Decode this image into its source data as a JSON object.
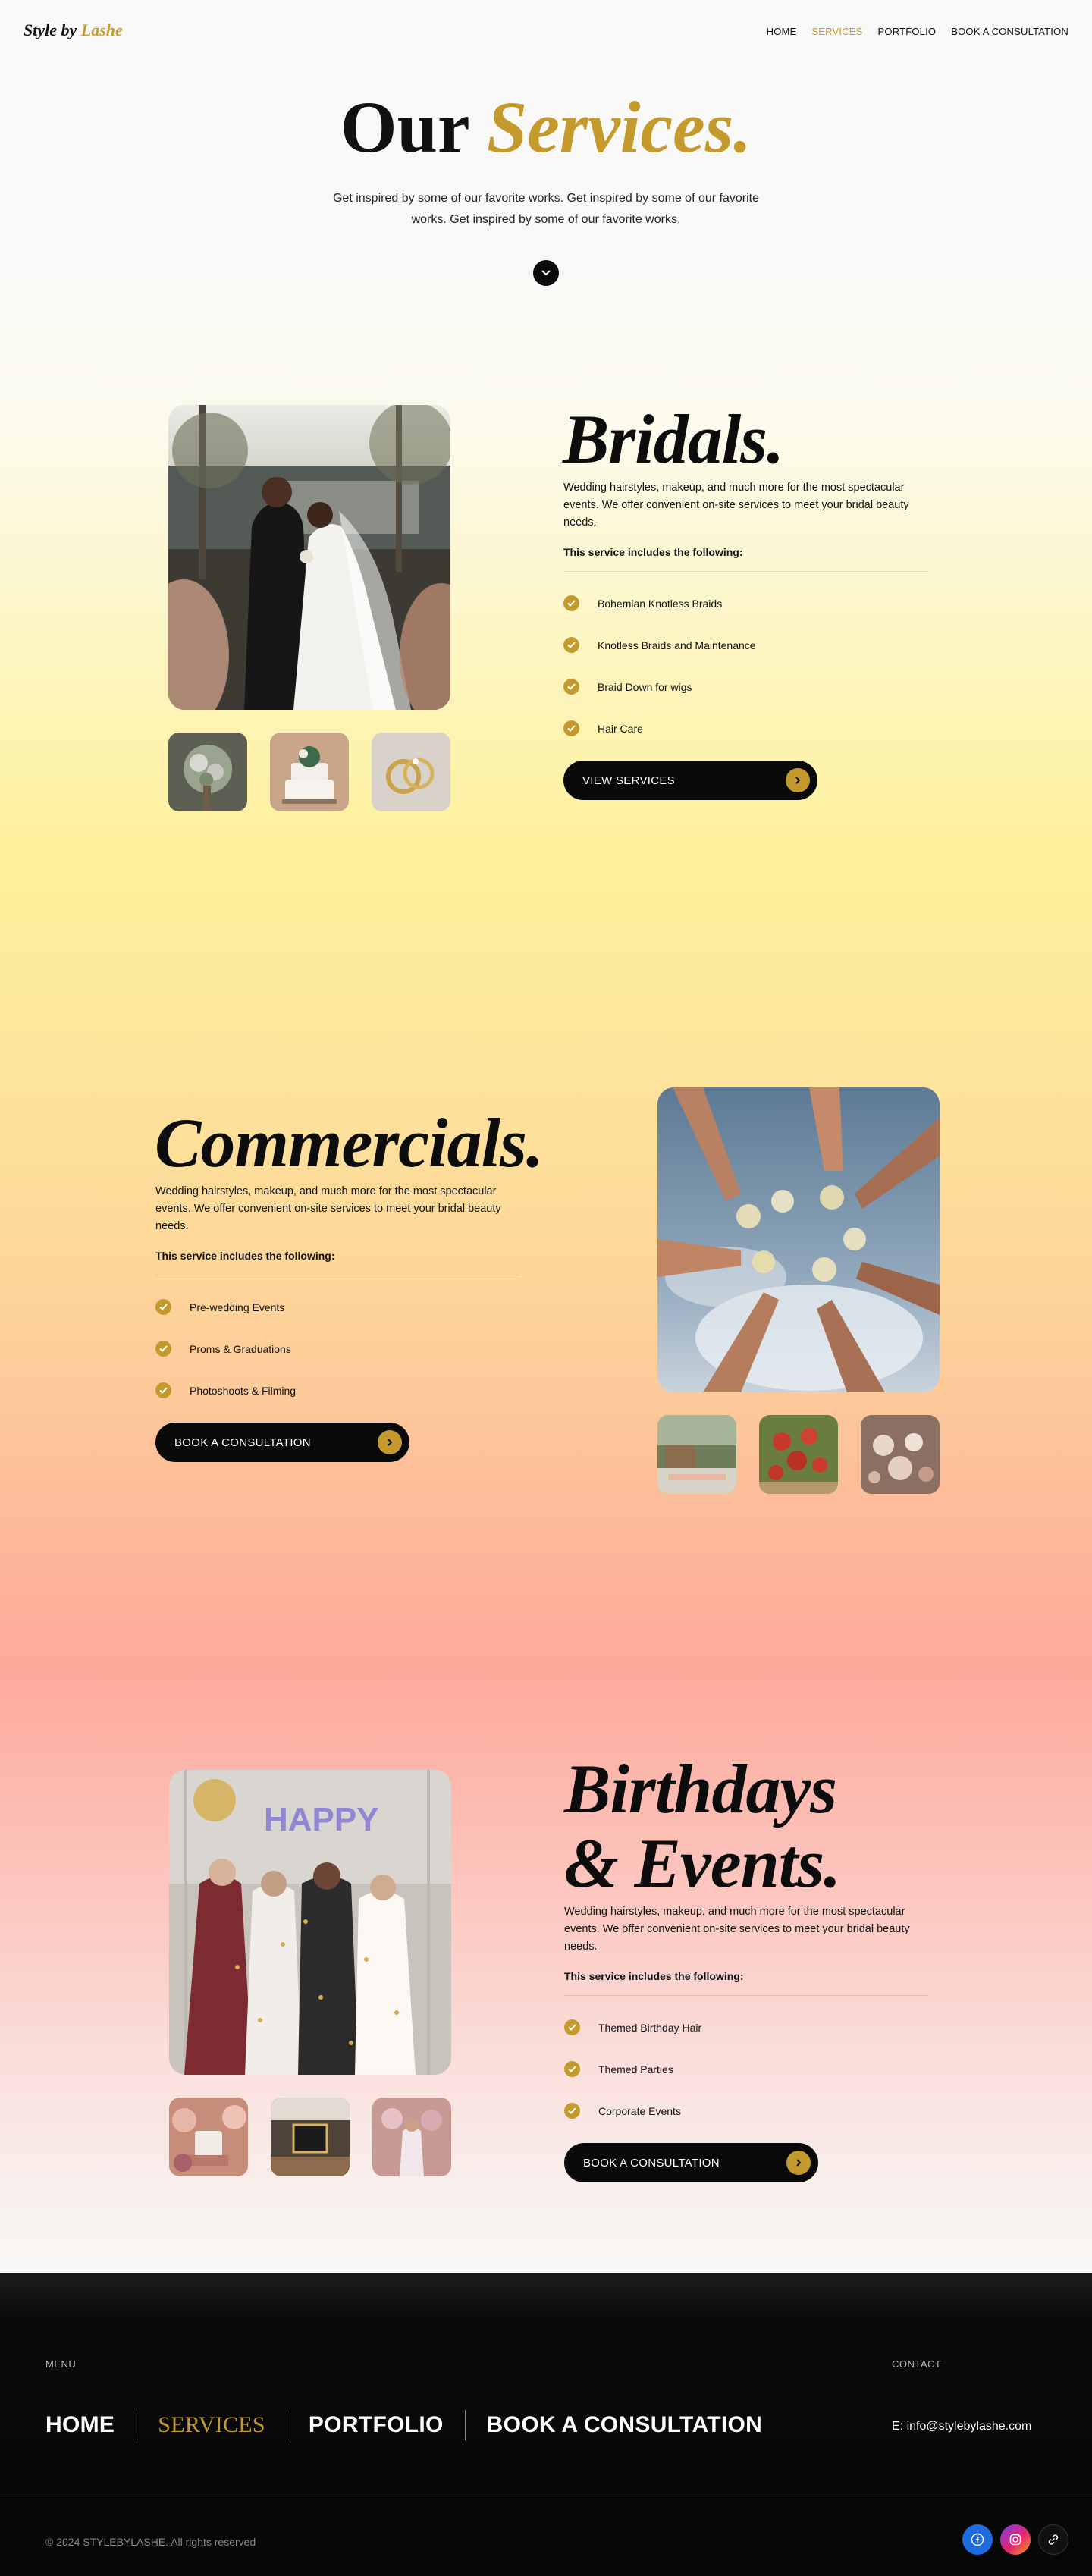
{
  "header": {
    "logo_prefix": "Style by",
    "logo_accent": "Lashe",
    "nav": [
      {
        "label": "HOME"
      },
      {
        "label": "SERVICES",
        "active": true
      },
      {
        "label": "PORTFOLIO"
      },
      {
        "label": "BOOK A CONSULTATION"
      }
    ]
  },
  "hero": {
    "title_plain": "Our",
    "title_accent": "Services.",
    "text": "Get inspired by some of our favorite works. Get inspired by some of our favorite works. Get inspired by some of our favorite works."
  },
  "services": [
    {
      "title": "Bridals.",
      "description": "Wedding hairstyles, makeup, and much more for the most spectacular events. We offer convenient on-site services to meet your bridal beauty needs.",
      "subheading": "This service includes the following:",
      "items": [
        "Bohemian Knotless Braids",
        "Knotless Braids and Maintenance",
        "Braid Down for wigs",
        "Hair Care"
      ],
      "button": "VIEW SERVICES"
    },
    {
      "title": "Commercials.",
      "description": "Wedding hairstyles, makeup, and much more for the most spectacular events. We offer convenient on-site services to meet your bridal beauty needs.",
      "subheading": "This service includes the following:",
      "items": [
        "Pre-wedding Events",
        "Proms & Graduations",
        "Photoshoots & Filming"
      ],
      "button": "BOOK A CONSULTATION"
    },
    {
      "title_line1": "Birthdays",
      "title_line2": "& Events.",
      "description": "Wedding hairstyles, makeup, and much more for the most spectacular events. We offer convenient on-site services to meet your bridal beauty needs.",
      "subheading": "This service includes the following:",
      "items": [
        "Themed Birthday Hair",
        "Themed Parties",
        "Corporate Events"
      ],
      "button": "BOOK A CONSULTATION"
    }
  ],
  "footer": {
    "menu_label": "MENU",
    "contact_label": "CONTACT",
    "links": [
      {
        "label": "HOME"
      },
      {
        "label": "SERVICES",
        "active": true
      },
      {
        "label": "PORTFOLIO"
      },
      {
        "label": "BOOK A CONSULTATION"
      }
    ],
    "email": "E: info@stylebylashe.com",
    "copyright": "© 2024 STYLEBYLASHE. All rights reserved",
    "socials": [
      {
        "icon": "facebook-icon"
      },
      {
        "icon": "instagram-icon"
      },
      {
        "icon": "link-icon"
      }
    ]
  },
  "colors": {
    "accent": "#c49a2c",
    "button": "#0a0a0a",
    "footer_bg": "#070707",
    "facebook": "#1f6be0"
  }
}
